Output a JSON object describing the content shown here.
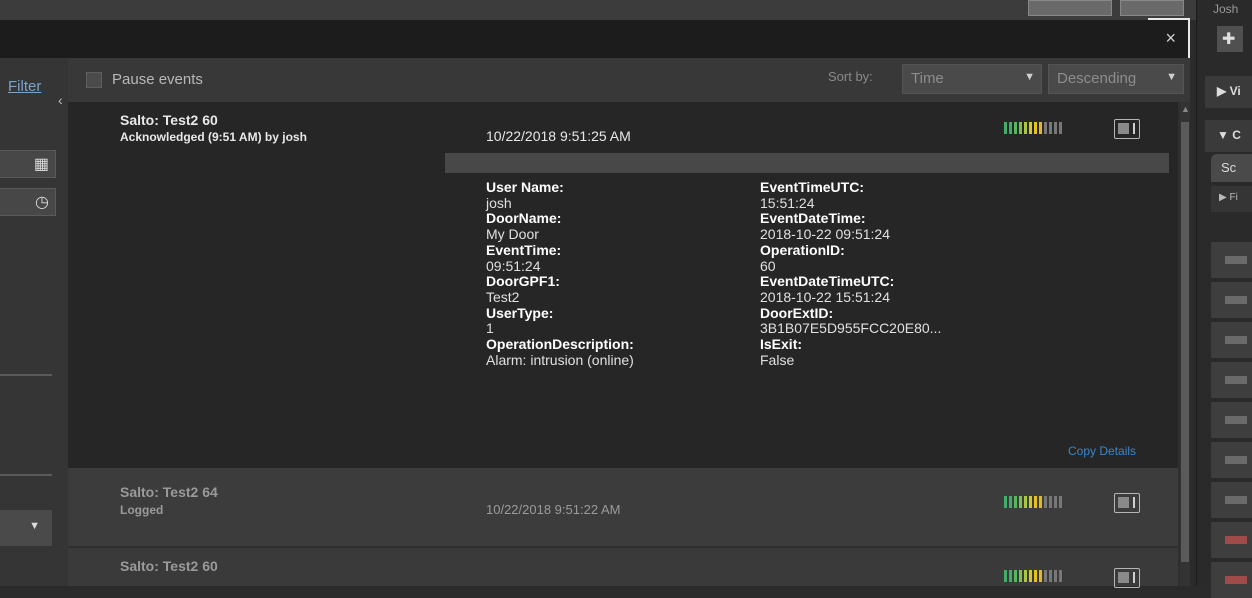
{
  "window": {
    "close_glyph": "×"
  },
  "left": {
    "filter_label": "Filter",
    "collapse_glyph": "‹",
    "calendar_icon": "▦",
    "clock_icon": "◷",
    "dropdown_glyph": "▼"
  },
  "header": {
    "pause_label": "Pause events",
    "sort_label": "Sort by:",
    "sort_field": "Time",
    "sort_order": "Descending",
    "arrow": "▼"
  },
  "events": [
    {
      "title": "Salto: Test2 60",
      "subtitle": "Acknowledged (9:51 AM) by josh",
      "date": "10/22/2018 9:51:25 AM",
      "details_left": [
        {
          "key": "User Name:",
          "value": "josh"
        },
        {
          "key": "DoorName:",
          "value": "My Door"
        },
        {
          "key": "EventTime:",
          "value": "09:51:24"
        },
        {
          "key": "DoorGPF1:",
          "value": "Test2"
        },
        {
          "key": "UserType:",
          "value": "1"
        },
        {
          "key": "OperationDescription:",
          "value": "Alarm: intrusion (online)"
        }
      ],
      "details_right": [
        {
          "key": "EventTimeUTC:",
          "value": "15:51:24"
        },
        {
          "key": "EventDateTime:",
          "value": "2018-10-22 09:51:24"
        },
        {
          "key": "OperationID:",
          "value": "60"
        },
        {
          "key": "EventDateTimeUTC:",
          "value": "2018-10-22 15:51:24"
        },
        {
          "key": "DoorExtID:",
          "value": "3B1B07E5D955FCC20E80..."
        },
        {
          "key": "IsExit:",
          "value": "False"
        }
      ],
      "copy_details": "Copy Details"
    },
    {
      "title": "Salto: Test2 64",
      "subtitle": "Logged",
      "date": "10/22/2018 9:51:22 AM"
    },
    {
      "title": "Salto: Test2 60",
      "subtitle": "",
      "date": ""
    }
  ],
  "priority_colors": [
    "#3fae6a",
    "#3fae6a",
    "#56b85e",
    "#7cc04f",
    "#a8c93f",
    "#d4c92c",
    "#e6c21e",
    "#e6b91a",
    "#777777",
    "#777777",
    "#777777",
    "#777777"
  ],
  "right": {
    "user": "Josh",
    "puzzle_icon": "puzzle-icon",
    "section1": "▶ Vi",
    "section2": "▼ C",
    "tab": "Sc",
    "filter": "▶ Fi"
  }
}
